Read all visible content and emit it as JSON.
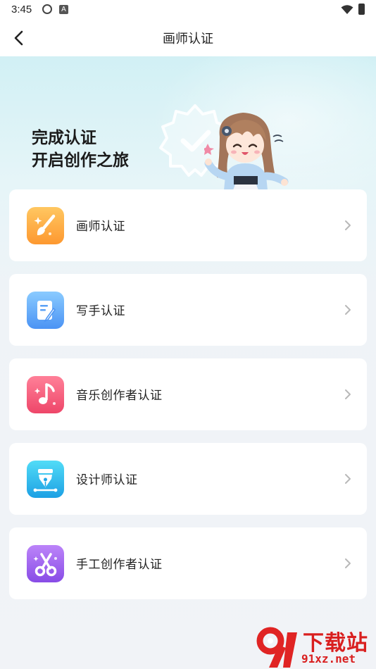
{
  "status_bar": {
    "time": "3:45"
  },
  "nav": {
    "title": "画师认证"
  },
  "banner": {
    "title": "完成认证",
    "subtitle": "开启创作之旅"
  },
  "items": [
    {
      "label": "画师认证",
      "icon": "brush-sparkle-icon",
      "color_top": "#ffc15a",
      "color_bottom": "#fd9a2e"
    },
    {
      "label": "写手认证",
      "icon": "notepad-pen-icon",
      "color_top": "#7fc4ff",
      "color_bottom": "#4a96f6"
    },
    {
      "label": "音乐创作者认证",
      "icon": "music-note-icon",
      "color_top": "#ff7a95",
      "color_bottom": "#ef4a6d"
    },
    {
      "label": "设计师认证",
      "icon": "pen-nib-icon",
      "color_top": "#4fd6f5",
      "color_bottom": "#1aa3e6"
    },
    {
      "label": "手工创作者认证",
      "icon": "scissors-icon",
      "color_top": "#b57cf7",
      "color_bottom": "#8b4fe8"
    }
  ],
  "watermark": {
    "brand": "下载站",
    "domain": "91xz.net"
  }
}
